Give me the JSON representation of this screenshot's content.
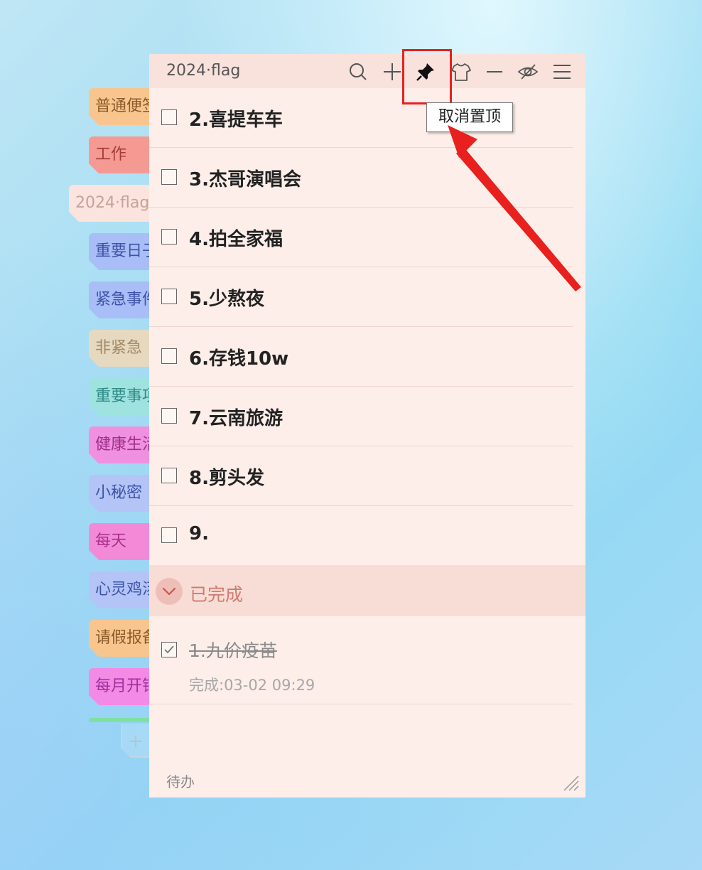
{
  "note": {
    "title": "2024·flag",
    "footer_label": "待办"
  },
  "sidebar": {
    "tabs": [
      {
        "label": "普通便签",
        "color": "#f9c58e",
        "text_color": "#8a5a2a"
      },
      {
        "label": "工作",
        "color": "#f59a93",
        "text_color": "#a23c34"
      },
      {
        "label": "2024·flag",
        "color": "#fbe4dd",
        "text_color": "#c5a39a",
        "active": true
      },
      {
        "label": "重要日子",
        "color": "#a9bdf6",
        "text_color": "#3e53a8"
      },
      {
        "label": "紧急事件",
        "color": "#a9bdf6",
        "text_color": "#3e53a8"
      },
      {
        "label": "非紧急",
        "color": "#e7d8c0",
        "text_color": "#a08a64"
      },
      {
        "label": "重要事项",
        "color": "#9ee3e0",
        "text_color": "#2f8a86"
      },
      {
        "label": "健康生活",
        "color": "#f090e0",
        "text_color": "#a0308a"
      },
      {
        "label": "小秘密",
        "color": "#b4c4f7",
        "text_color": "#3e53a8"
      },
      {
        "label": "每天",
        "color": "#f38ad8",
        "text_color": "#a8308c"
      },
      {
        "label": "心灵鸡汤",
        "color": "#b4c4f7",
        "text_color": "#3e53a8"
      },
      {
        "label": "请假报备",
        "color": "#f9c58e",
        "text_color": "#8a5a2a"
      },
      {
        "label": "每月开销",
        "color": "#f28ae6",
        "text_color": "#a0309a"
      }
    ]
  },
  "toolbar": {
    "icons": [
      "search-icon",
      "add-icon",
      "pin-icon",
      "shirt-icon",
      "minimize-icon",
      "hide-icon",
      "menu-icon"
    ],
    "pin_tooltip": "取消置顶"
  },
  "todos": [
    {
      "text": "2.喜提车车",
      "checked": false
    },
    {
      "text": "3.杰哥演唱会",
      "checked": false
    },
    {
      "text": "4.拍全家福",
      "checked": false
    },
    {
      "text": "5.少熬夜",
      "checked": false
    },
    {
      "text": "6.存钱10w",
      "checked": false
    },
    {
      "text": "7.云南旅游",
      "checked": false
    },
    {
      "text": "8.剪头发",
      "checked": false
    },
    {
      "text": "9.",
      "checked": false
    }
  ],
  "completed": {
    "label": "已完成",
    "items": [
      {
        "text": "1.九价疫苗",
        "time": "完成:03-02 09:29",
        "checked": true
      }
    ]
  },
  "colors": {
    "annotation_red": "#e8201e",
    "panel_bg": "#fdeee9"
  }
}
